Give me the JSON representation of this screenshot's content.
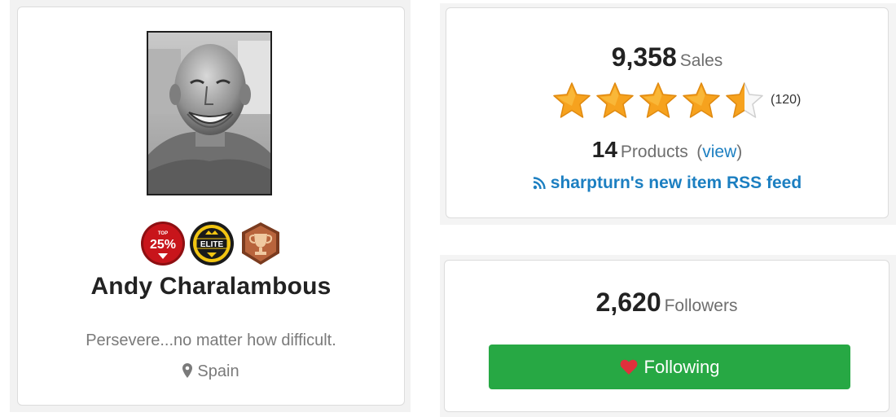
{
  "profile": {
    "name": "Andy Charalambous",
    "tagline": "Persevere...no matter how difficult.",
    "location": "Spain",
    "badges": [
      {
        "icon": "top-25-badge-icon",
        "label": "25%",
        "sublabel": "TOP",
        "color": "#c8151b"
      },
      {
        "icon": "elite-badge-icon",
        "label": "ELITE",
        "color": "#f2c512"
      },
      {
        "icon": "trophy-badge-icon",
        "color": "#b8643c"
      }
    ]
  },
  "stats": {
    "sales_count": "9,358",
    "sales_label": "Sales",
    "rating": 4.5,
    "rating_count": "(120)",
    "products_count": "14",
    "products_label": "Products",
    "view_open": "(",
    "view_label": "view",
    "view_close": ")",
    "rss_label": "sharpturn's new item RSS feed"
  },
  "followers": {
    "count": "2,620",
    "label": "Followers",
    "button_label": "Following"
  },
  "colors": {
    "accent_green": "#27a844",
    "link_blue": "#1c7fc1",
    "star_gold": "#f6a21e",
    "heart_red": "#e0303c"
  }
}
